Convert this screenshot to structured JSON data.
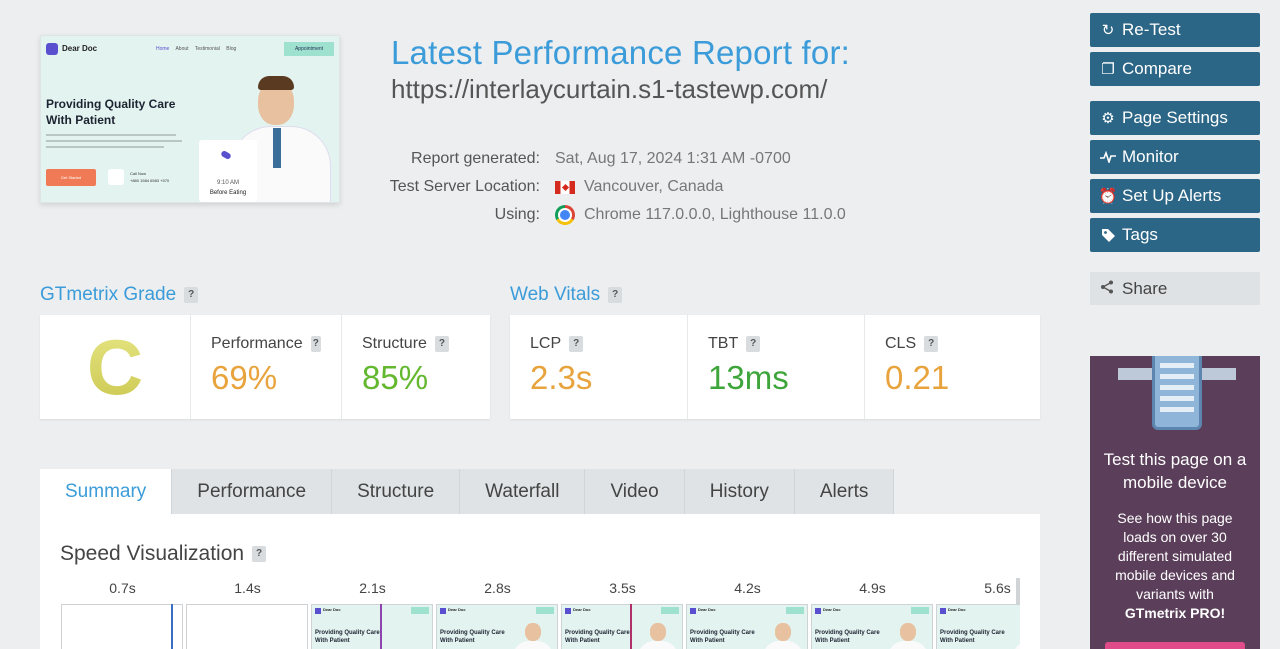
{
  "screenshot": {
    "brand": "Dear Doc",
    "nav_links": [
      "Home",
      "About",
      "Testimonial",
      "Blog"
    ],
    "appointment": "Appointment",
    "hero_title": "Providing Quality Care With Patient",
    "cta": "Get Started",
    "call_label": "Call Now",
    "phone": "+880 1584 6583 +570",
    "card_time": "9:10 AM",
    "card_label": "Before Eating"
  },
  "report": {
    "title": "Latest Performance Report for:",
    "url": "https://interlaycurtain.s1-tastewp.com/",
    "labels": {
      "generated": "Report generated:",
      "server": "Test Server Location:",
      "using": "Using:"
    },
    "generated": "Sat, Aug 17, 2024 1:31 AM -0700",
    "server": "Vancouver, Canada",
    "using": "Chrome 117.0.0.0, Lighthouse 11.0.0"
  },
  "grade": {
    "heading": "GTmetrix Grade",
    "letter": "C",
    "performance_label": "Performance",
    "performance": "69%",
    "structure_label": "Structure",
    "structure": "85%"
  },
  "vitals": {
    "heading": "Web Vitals",
    "lcp_label": "LCP",
    "lcp": "2.3s",
    "tbt_label": "TBT",
    "tbt": "13ms",
    "cls_label": "CLS",
    "cls": "0.21"
  },
  "help_mark": "?",
  "tabs": [
    "Summary",
    "Performance",
    "Structure",
    "Waterfall",
    "Video",
    "History",
    "Alerts"
  ],
  "speed": {
    "title": "Speed Visualization",
    "times": [
      "0.7s",
      "1.4s",
      "2.1s",
      "2.8s",
      "3.5s",
      "4.2s",
      "4.9s",
      "5.6s"
    ],
    "frame_brand": "Dear Doc",
    "frame_title": "Providing Quality Care With Patient"
  },
  "sidebar": {
    "retest": "Re-Test",
    "compare": "Compare",
    "page_settings": "Page Settings",
    "monitor": "Monitor",
    "alerts": "Set Up Alerts",
    "tags": "Tags",
    "share": "Share"
  },
  "promo": {
    "title": "Test this page on a mobile device",
    "body": "See how this page loads on over 30 different simulated mobile devices and variants with",
    "brand": "GTmetrix PRO!"
  },
  "colors": {
    "accent": "#3b9cd9",
    "button": "#2c6686",
    "warning": "#e8a33d",
    "good": "#63b82f",
    "great": "#3ea53a",
    "grade_c": "#d6d44c"
  }
}
